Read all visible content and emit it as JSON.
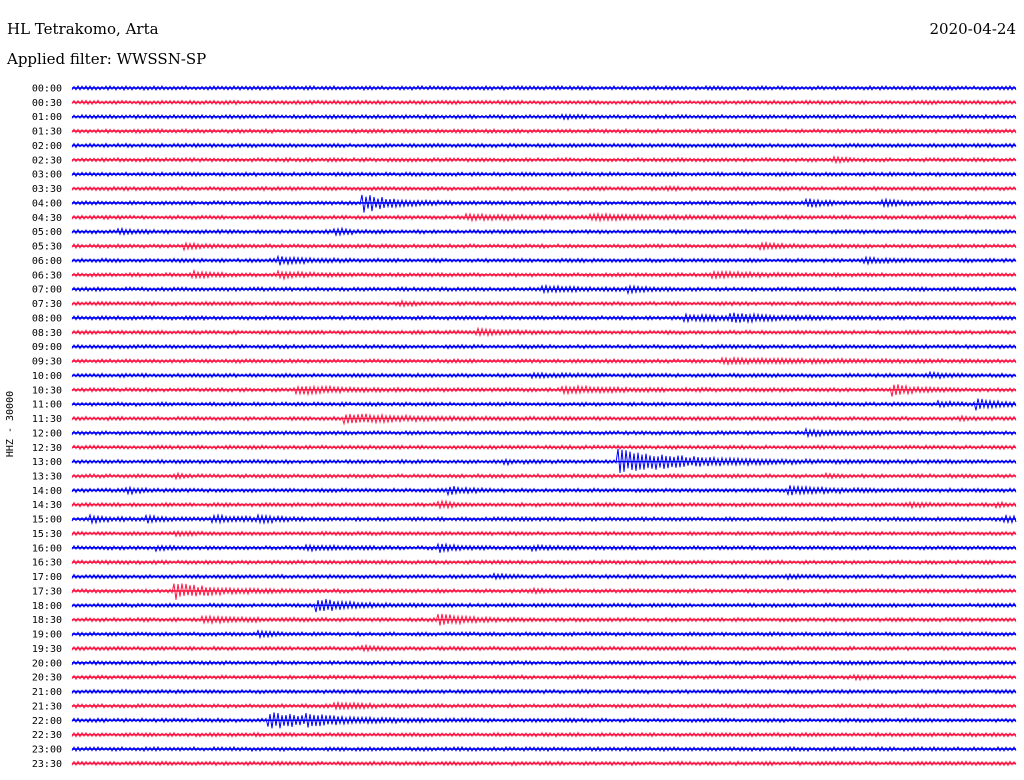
{
  "header": {
    "station": "HL Tetrakomo, Arta",
    "date": "2020-04-24",
    "filter": "Applied filter: WWSSN-SP"
  },
  "chart_data": {
    "type": "line",
    "title": "HL Tetrakomo, Arta",
    "subtitle": "Applied filter: WWSSN-SP",
    "ylabel": "HHZ - 30000",
    "xlabel": "",
    "grid": false,
    "legend": "none",
    "colors": [
      "#0000ff",
      "#ff1744"
    ],
    "row_labels": [
      "00:00",
      "00:30",
      "01:00",
      "01:30",
      "02:00",
      "02:30",
      "03:00",
      "03:30",
      "04:00",
      "04:30",
      "05:00",
      "05:30",
      "06:00",
      "06:30",
      "07:00",
      "07:30",
      "08:00",
      "08:30",
      "09:00",
      "09:30",
      "10:00",
      "10:30",
      "11:00",
      "11:30",
      "12:00",
      "12:30",
      "13:00",
      "13:30",
      "14:00",
      "14:30",
      "15:00",
      "15:30",
      "16:00",
      "16:30",
      "17:00",
      "17:30",
      "18:00",
      "18:30",
      "19:00",
      "19:30",
      "20:00",
      "20:30",
      "21:00",
      "21:30",
      "22:00",
      "22:30",
      "23:00",
      "23:30"
    ],
    "events": [
      {
        "row": 2,
        "t": 0.52,
        "amp": 0.6,
        "dur": 0.012
      },
      {
        "row": 5,
        "t": 0.81,
        "amp": 0.6,
        "dur": 0.012
      },
      {
        "row": 7,
        "t": 0.63,
        "amp": 0.4,
        "dur": 0.012
      },
      {
        "row": 8,
        "t": 0.31,
        "amp": 3.2,
        "dur": 0.03
      },
      {
        "row": 8,
        "t": 0.78,
        "amp": 1.2,
        "dur": 0.02
      },
      {
        "row": 8,
        "t": 0.86,
        "amp": 1.0,
        "dur": 0.02
      },
      {
        "row": 9,
        "t": 0.42,
        "amp": 0.8,
        "dur": 0.08
      },
      {
        "row": 9,
        "t": 0.55,
        "amp": 0.7,
        "dur": 0.08
      },
      {
        "row": 10,
        "t": 0.05,
        "amp": 0.7,
        "dur": 0.02
      },
      {
        "row": 10,
        "t": 0.28,
        "amp": 1.0,
        "dur": 0.015
      },
      {
        "row": 11,
        "t": 0.12,
        "amp": 0.8,
        "dur": 0.02
      },
      {
        "row": 11,
        "t": 0.73,
        "amp": 0.9,
        "dur": 0.02
      },
      {
        "row": 12,
        "t": 0.22,
        "amp": 1.2,
        "dur": 0.03
      },
      {
        "row": 12,
        "t": 0.84,
        "amp": 1.0,
        "dur": 0.02
      },
      {
        "row": 13,
        "t": 0.13,
        "amp": 0.9,
        "dur": 0.02
      },
      {
        "row": 13,
        "t": 0.22,
        "amp": 1.0,
        "dur": 0.03
      },
      {
        "row": 13,
        "t": 0.68,
        "amp": 1.0,
        "dur": 0.04
      },
      {
        "row": 14,
        "t": 0.5,
        "amp": 0.9,
        "dur": 0.04
      },
      {
        "row": 14,
        "t": 0.59,
        "amp": 1.1,
        "dur": 0.02
      },
      {
        "row": 15,
        "t": 0.35,
        "amp": 0.6,
        "dur": 0.012
      },
      {
        "row": 16,
        "t": 0.65,
        "amp": 1.0,
        "dur": 0.06
      },
      {
        "row": 16,
        "t": 0.7,
        "amp": 1.1,
        "dur": 0.04
      },
      {
        "row": 17,
        "t": 0.43,
        "amp": 0.9,
        "dur": 0.03
      },
      {
        "row": 19,
        "t": 0.69,
        "amp": 0.8,
        "dur": 0.1
      },
      {
        "row": 20,
        "t": 0.49,
        "amp": 0.6,
        "dur": 0.03
      },
      {
        "row": 20,
        "t": 0.91,
        "amp": 0.7,
        "dur": 0.02
      },
      {
        "row": 21,
        "t": 0.24,
        "amp": 1.3,
        "dur": 0.05
      },
      {
        "row": 21,
        "t": 0.52,
        "amp": 1.0,
        "dur": 0.06
      },
      {
        "row": 21,
        "t": 0.87,
        "amp": 2.0,
        "dur": 0.02
      },
      {
        "row": 22,
        "t": 0.92,
        "amp": 0.8,
        "dur": 0.012
      },
      {
        "row": 22,
        "t": 0.96,
        "amp": 1.8,
        "dur": 0.02
      },
      {
        "row": 23,
        "t": 0.29,
        "amp": 1.6,
        "dur": 0.06
      },
      {
        "row": 23,
        "t": 0.94,
        "amp": 0.6,
        "dur": 0.012
      },
      {
        "row": 24,
        "t": 0.78,
        "amp": 1.0,
        "dur": 0.03
      },
      {
        "row": 26,
        "t": 0.46,
        "amp": 0.6,
        "dur": 0.012
      },
      {
        "row": 26,
        "t": 0.58,
        "amp": 4.5,
        "dur": 0.07
      },
      {
        "row": 27,
        "t": 0.11,
        "amp": 0.5,
        "dur": 0.012
      },
      {
        "row": 27,
        "t": 0.8,
        "amp": 0.6,
        "dur": 0.012
      },
      {
        "row": 28,
        "t": 0.06,
        "amp": 0.8,
        "dur": 0.015
      },
      {
        "row": 28,
        "t": 0.4,
        "amp": 1.2,
        "dur": 0.02
      },
      {
        "row": 28,
        "t": 0.76,
        "amp": 1.2,
        "dur": 0.05
      },
      {
        "row": 29,
        "t": 0.39,
        "amp": 1.0,
        "dur": 0.015
      },
      {
        "row": 29,
        "t": 0.89,
        "amp": 0.7,
        "dur": 0.012
      },
      {
        "row": 29,
        "t": 0.98,
        "amp": 0.7,
        "dur": 0.012
      },
      {
        "row": 30,
        "t": 0.02,
        "amp": 1.0,
        "dur": 0.02
      },
      {
        "row": 30,
        "t": 0.08,
        "amp": 1.1,
        "dur": 0.015
      },
      {
        "row": 30,
        "t": 0.15,
        "amp": 1.2,
        "dur": 0.03
      },
      {
        "row": 30,
        "t": 0.2,
        "amp": 1.0,
        "dur": 0.02
      },
      {
        "row": 30,
        "t": 0.99,
        "amp": 1.2,
        "dur": 0.015
      },
      {
        "row": 31,
        "t": 0.11,
        "amp": 0.6,
        "dur": 0.012
      },
      {
        "row": 32,
        "t": 0.09,
        "amp": 0.6,
        "dur": 0.012
      },
      {
        "row": 32,
        "t": 0.25,
        "amp": 0.7,
        "dur": 0.03
      },
      {
        "row": 32,
        "t": 0.39,
        "amp": 1.4,
        "dur": 0.015
      },
      {
        "row": 32,
        "t": 0.49,
        "amp": 0.6,
        "dur": 0.03
      },
      {
        "row": 34,
        "t": 0.45,
        "amp": 0.6,
        "dur": 0.012
      },
      {
        "row": 34,
        "t": 0.76,
        "amp": 0.6,
        "dur": 0.012
      },
      {
        "row": 35,
        "t": 0.11,
        "amp": 2.8,
        "dur": 0.04
      },
      {
        "row": 35,
        "t": 0.49,
        "amp": 0.6,
        "dur": 0.012
      },
      {
        "row": 36,
        "t": 0.26,
        "amp": 2.6,
        "dur": 0.03
      },
      {
        "row": 37,
        "t": 0.14,
        "amp": 1.0,
        "dur": 0.04
      },
      {
        "row": 37,
        "t": 0.39,
        "amp": 2.0,
        "dur": 0.03
      },
      {
        "row": 38,
        "t": 0.2,
        "amp": 0.8,
        "dur": 0.012
      },
      {
        "row": 39,
        "t": 0.31,
        "amp": 0.6,
        "dur": 0.015
      },
      {
        "row": 41,
        "t": 0.83,
        "amp": 0.6,
        "dur": 0.012
      },
      {
        "row": 43,
        "t": 0.28,
        "amp": 1.0,
        "dur": 0.03
      },
      {
        "row": 44,
        "t": 0.21,
        "amp": 3.0,
        "dur": 0.06
      },
      {
        "row": 44,
        "t": 0.25,
        "amp": 1.0,
        "dur": 0.03
      }
    ]
  }
}
